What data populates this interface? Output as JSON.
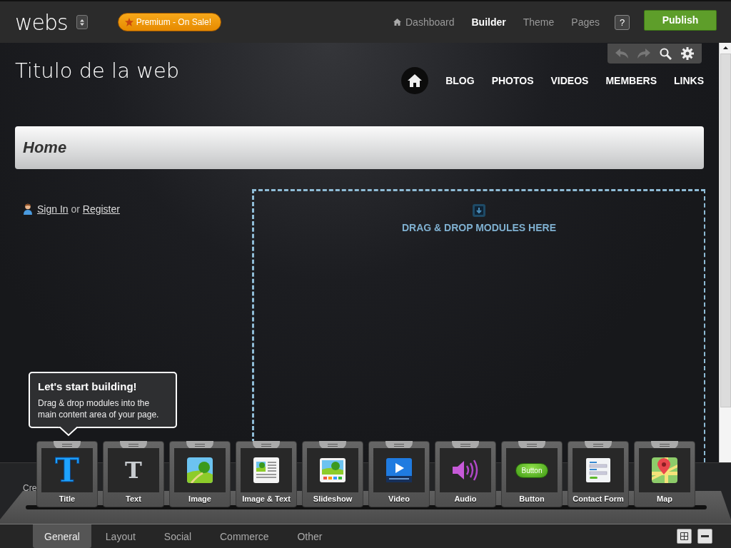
{
  "topbar": {
    "logo": "webs",
    "premium": "Premium - On Sale!",
    "nav": [
      {
        "label": "Dashboard",
        "selected": false,
        "kind": "home"
      },
      {
        "label": "Builder",
        "selected": true,
        "kind": "plain"
      },
      {
        "label": "Theme",
        "selected": false,
        "kind": "plain"
      },
      {
        "label": "Pages",
        "selected": false,
        "kind": "plain"
      }
    ],
    "help": "?",
    "publish": "Publish"
  },
  "site": {
    "title": "Titulo de la web",
    "menu": [
      "BLOG",
      "PHOTOS",
      "VIDEOS",
      "MEMBERS",
      "LINKS"
    ],
    "page_heading": "Home",
    "sign_in": "Sign In",
    "or": "or",
    "register": "Register",
    "drop_hint": "DRAG & DROP MODULES HERE",
    "footer_fragment": "Cre"
  },
  "tooltip": {
    "title": "Let's start building!",
    "body": "Drag & drop modules into the main content area of your page."
  },
  "modules": [
    {
      "label": "Title",
      "kind": "title",
      "icon_text": "T"
    },
    {
      "label": "Text",
      "kind": "text",
      "icon_text": "T"
    },
    {
      "label": "Image",
      "kind": "image"
    },
    {
      "label": "Image & Text",
      "kind": "image-text"
    },
    {
      "label": "Slideshow",
      "kind": "slideshow"
    },
    {
      "label": "Video",
      "kind": "video"
    },
    {
      "label": "Audio",
      "kind": "audio"
    },
    {
      "label": "Button",
      "kind": "button",
      "icon_text": "Button"
    },
    {
      "label": "Contact Form",
      "kind": "form"
    },
    {
      "label": "Map",
      "kind": "map"
    }
  ],
  "dock_tabs": [
    {
      "label": "General",
      "selected": true
    },
    {
      "label": "Layout",
      "selected": false
    },
    {
      "label": "Social",
      "selected": false
    },
    {
      "label": "Commerce",
      "selected": false
    },
    {
      "label": "Other",
      "selected": false
    }
  ]
}
